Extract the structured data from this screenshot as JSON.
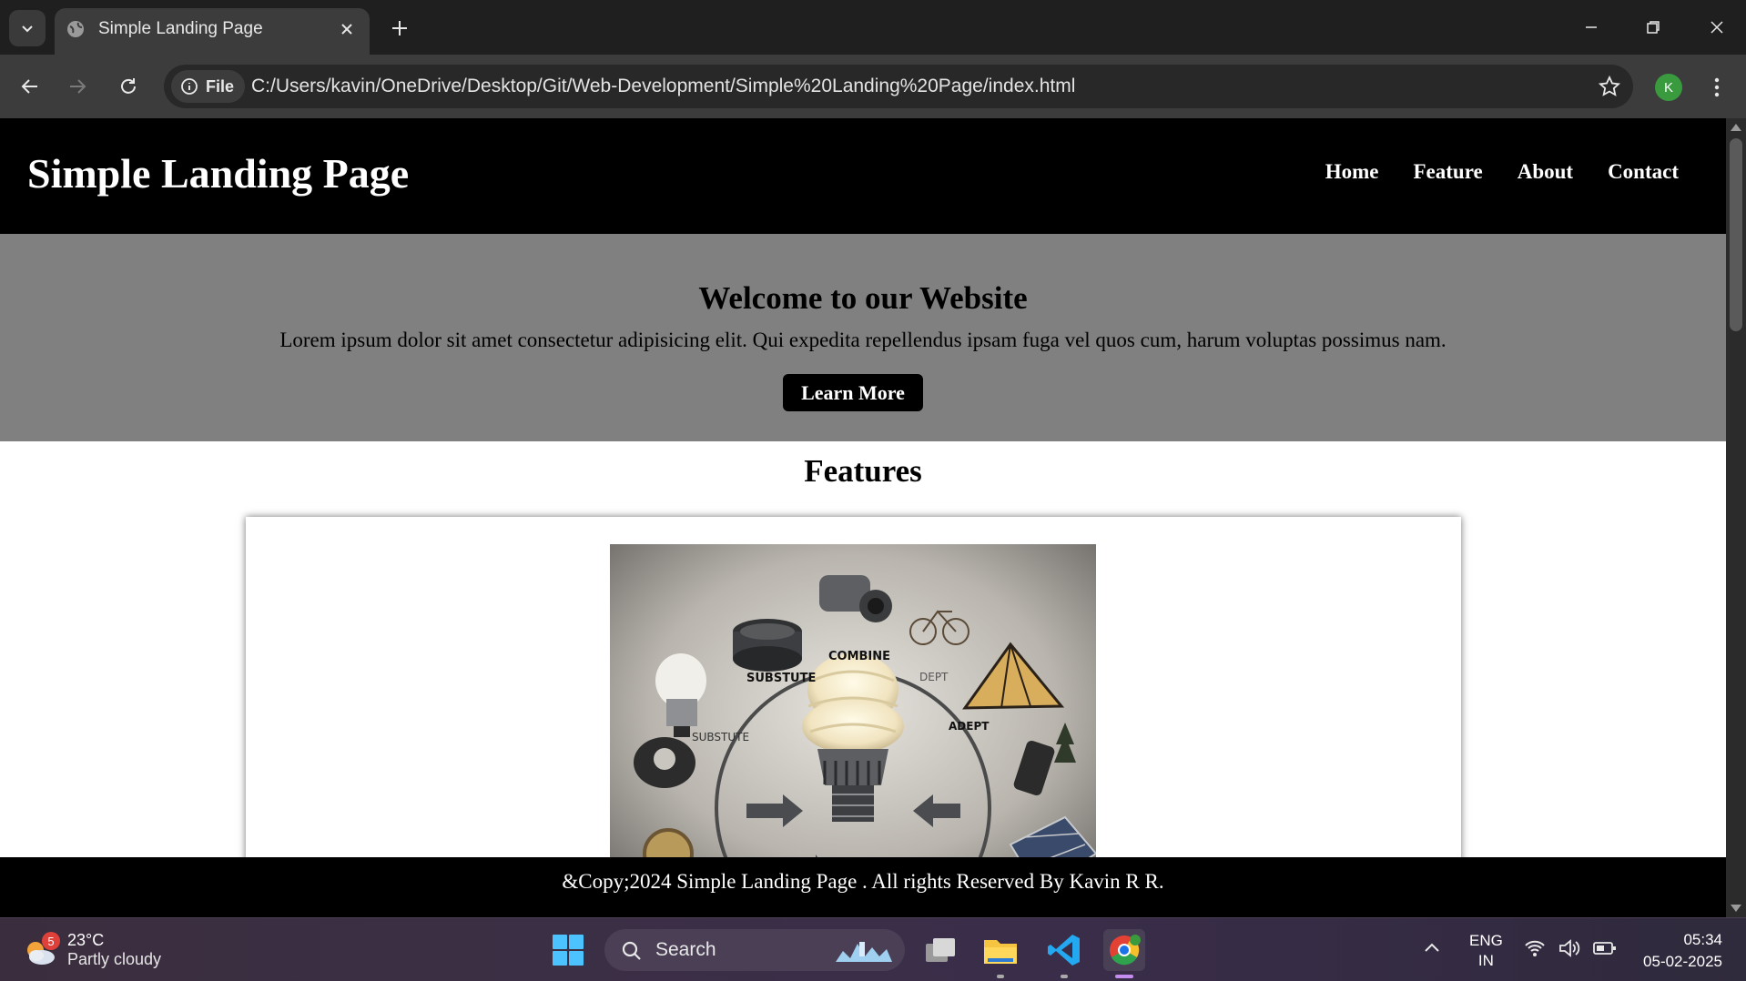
{
  "browser": {
    "tab_title": "Simple Landing Page",
    "site_chip_label": "File",
    "url": "C:/Users/kavin/OneDrive/Desktop/Git/Web-Development/Simple%20Landing%20Page/index.html",
    "profile_initial": "K"
  },
  "page": {
    "logo": "Simple Landing Page",
    "nav": [
      "Home",
      "Feature",
      "About",
      "Contact"
    ],
    "hero": {
      "title": "Welcome to our Website",
      "text": "Lorem ipsum dolor sit amet consectetur adipisicing elit. Qui expedita repellendus ipsam fuga vel quos cum, harum voluptas possimus nam.",
      "button": "Learn More"
    },
    "features_title": "Features",
    "feature_image_labels": [
      "COMBINE",
      "SUBSTUTE",
      "DEPT",
      "ADEPT",
      "SUBSTUTE"
    ],
    "footer": "&Copy;2024 Simple Landing Page . All rights Reserved By Kavin R R."
  },
  "taskbar": {
    "weather_badge": "5",
    "weather_temp": "23°C",
    "weather_desc": "Partly cloudy",
    "search_label": "Search",
    "lang_line1": "ENG",
    "lang_line2": "IN",
    "time": "05:34",
    "date": "05-02-2025"
  }
}
